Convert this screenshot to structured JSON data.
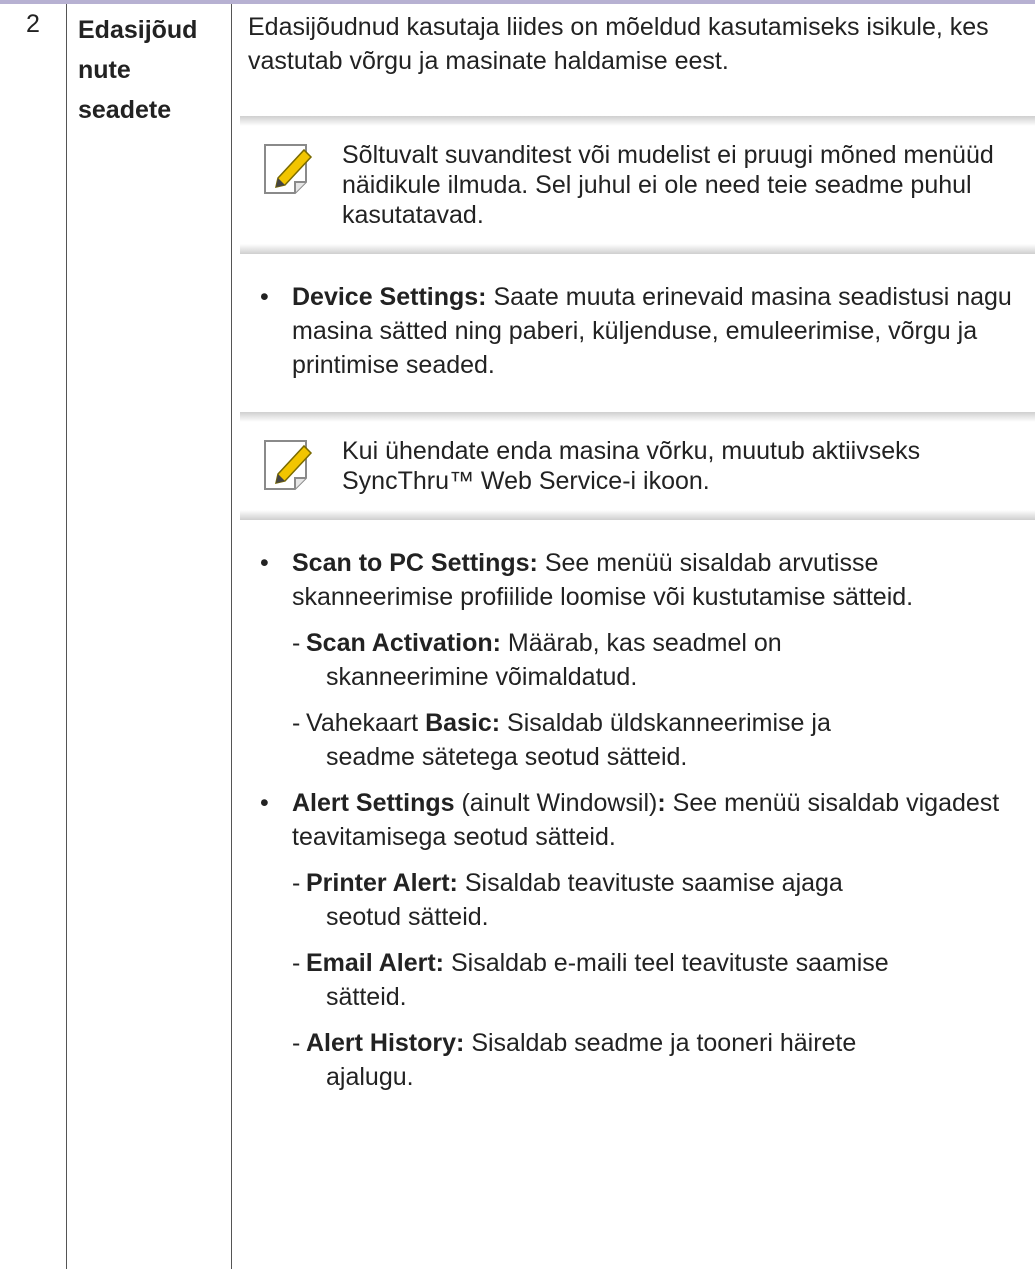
{
  "row_number": "2",
  "row_name_lines": [
    "Edasijõud",
    "nute",
    "seadete"
  ],
  "intro": "Edasijõudnud kasutaja liides on mõeldud kasutamiseks isikule, kes vastutab võrgu ja masinate haldamise eest.",
  "note1": "Sõltuvalt suvanditest või mudelist ei pruugi mõned menüüd näidikule ilmuda. Sel juhul ei ole need teie seadme puhul kasutatavad.",
  "bullet1": {
    "bold": "Device Settings:",
    "text": " Saate muuta erinevaid masina seadistusi nagu masina sätted ning paberi, küljenduse, emuleerimise, võrgu ja printimise seaded."
  },
  "note2": "Kui ühendate enda masina võrku, muutub aktiivseks SyncThru™ Web Service-i ikoon.",
  "bullet2": {
    "bold": "Scan to PC Settings:",
    "text": " See menüü sisaldab arvutisse skanneerimise profiilide loomise või kustutamise sätteid."
  },
  "sub2a": {
    "bold": "Scan Activation:",
    "line1": " Määrab, kas seadmel on",
    "line2": "skanneerimine võimaldatud."
  },
  "sub2b": {
    "prefix": "Vahekaart ",
    "bold": "Basic:",
    "line1": " Sisaldab üldskanneerimise ja",
    "line2": "seadme sätetega seotud sätteid."
  },
  "bullet3": {
    "bold": "Alert Settings",
    "middle": " (ainult Windowsil)",
    "bold2": ":",
    "text": " See menüü sisaldab vigadest teavitamisega seotud sätteid."
  },
  "sub3a": {
    "bold": "Printer Alert:",
    "line1": " Sisaldab teavituste saamise ajaga",
    "line2": "seotud sätteid."
  },
  "sub3b": {
    "bold": "Email Alert:",
    "line1": " Sisaldab e-maili teel teavituste saamise",
    "line2": "sätteid."
  },
  "sub3c": {
    "bold": "Alert History:",
    "line1": " Sisaldab seadme ja tooneri häirete",
    "line2": "ajalugu."
  },
  "icons": {
    "note": "note-pencil-icon"
  },
  "colors": {
    "header_bar": "#b7b1d2",
    "note_shade": "#cfcfcf"
  }
}
